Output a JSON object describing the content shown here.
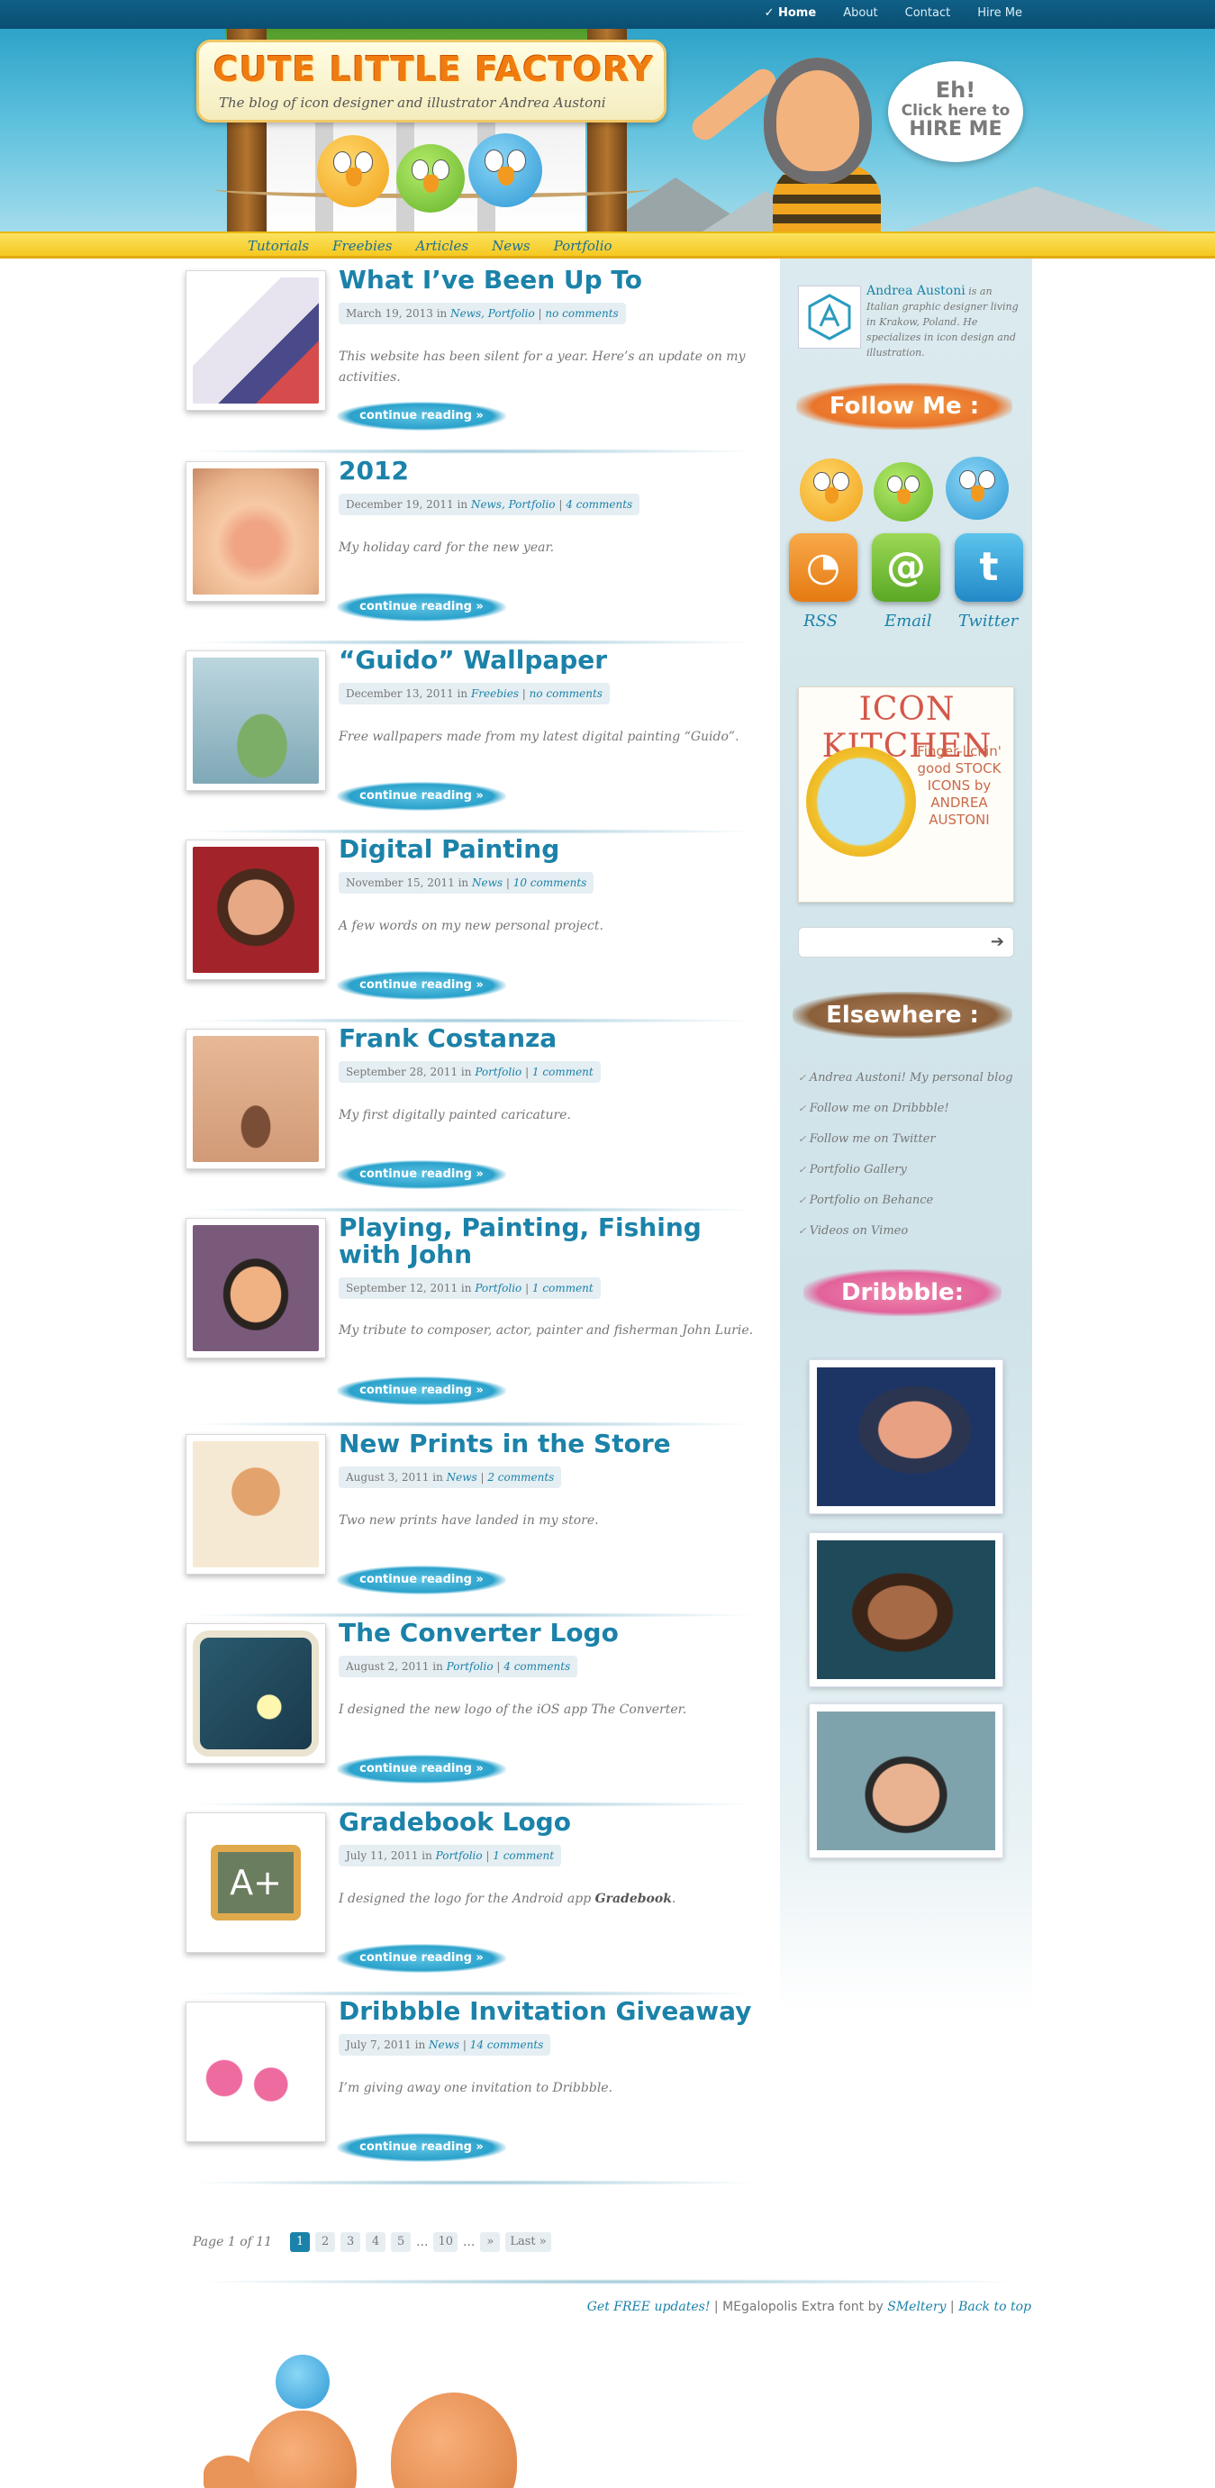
{
  "top_nav": [
    {
      "label": "Home",
      "active": true,
      "check": "✓"
    },
    {
      "label": "About"
    },
    {
      "label": "Contact"
    },
    {
      "label": "Hire Me"
    }
  ],
  "header": {
    "logo_title": "CUTE LITTLE FACTORY",
    "tagline": "The blog of icon designer and illustrator Andrea Austoni",
    "speech_l1": "Eh!",
    "speech_l2": "Click here to",
    "speech_l3": "HIRE ME"
  },
  "categories": [
    "Tutorials",
    "Freebies",
    "Articles",
    "News",
    "Portfolio"
  ],
  "posts": [
    {
      "title": "What I’ve Been Up To",
      "date": "March 19, 2013",
      "in": "in",
      "cats": "News, Portfolio",
      "comments": "no comments",
      "excerpt": "This website has been silent for a year. Here’s an update on my activities.",
      "cta": "continue reading »",
      "thumb_icon": "card-king-caricature-icon"
    },
    {
      "title": "2012",
      "date": "December 19, 2011",
      "in": "in",
      "cats": "News, Portfolio",
      "comments": "4 comments",
      "excerpt": "My holiday card for the new year.",
      "cta": "continue reading »",
      "thumb_icon": "old-face-caricature-icon"
    },
    {
      "title": "“Guido” Wallpaper",
      "date": "December 13, 2011",
      "in": "in",
      "cats": "Freebies",
      "comments": "no comments",
      "excerpt": "Free wallpapers made from my latest digital painting “Guido”.",
      "cta": "continue reading »",
      "thumb_icon": "kiwi-bird-icon"
    },
    {
      "title": "Digital Painting",
      "date": "November 15, 2011",
      "in": "in",
      "cats": "News",
      "comments": "10 comments",
      "excerpt": "A few words on my new personal project.",
      "cta": "continue reading »",
      "thumb_icon": "boy-portrait-icon"
    },
    {
      "title": "Frank Costanza",
      "date": "September 28, 2011",
      "in": "in",
      "cats": "Portfolio",
      "comments": "1 comment",
      "excerpt": "My first digitally painted caricature.",
      "cta": "continue reading »",
      "thumb_icon": "mustache-face-icon"
    },
    {
      "title": "Playing, Painting, Fishing with John",
      "date": "September 12, 2011",
      "in": "in",
      "cats": "Portfolio",
      "comments": "1 comment",
      "excerpt": "My tribute to composer, actor, painter and fisherman John Lurie.",
      "cta": "continue reading »",
      "thumb_icon": "john-caricature-icon"
    },
    {
      "title": "New Prints in the Store",
      "date": "August 3, 2011",
      "in": "in",
      "cats": "News",
      "comments": "2 comments",
      "excerpt": "Two new prints have landed in my store.",
      "cta": "continue reading »",
      "thumb_icon": "print-character-icon"
    },
    {
      "title": "The Converter Logo",
      "date": "August 2, 2011",
      "in": "in",
      "cats": "Portfolio",
      "comments": "4 comments",
      "excerpt": "I designed the new logo of the iOS app The Converter.",
      "cta": "continue reading »",
      "thumb_icon": "converter-app-icon"
    },
    {
      "title": "Gradebook Logo",
      "date": "July 11, 2011",
      "in": "in",
      "cats": "Portfolio",
      "comments": "1 comment",
      "excerpt_pre": "I designed the logo for the Android app ",
      "excerpt_bold": "Gradebook",
      "excerpt_post": ".",
      "cta": "continue reading »",
      "thumb_icon": "gradebook-a-plus-icon"
    },
    {
      "title": "Dribbble Invitation Giveaway",
      "date": "July 7, 2011",
      "in": "in",
      "cats": "News",
      "comments": "14 comments",
      "excerpt": "I’m giving away one invitation to Dribbble.",
      "cta": "continue reading »",
      "thumb_icon": "dribbble-balls-icon"
    }
  ],
  "pagination": {
    "info": "Page 1 of 11",
    "pages": [
      "1",
      "2",
      "3",
      "4",
      "5"
    ],
    "dots": "...",
    "ten": "10",
    "next": "»",
    "last": "Last »"
  },
  "sidebar": {
    "author_name": "Andrea Austoni",
    "author_bio": " is an Italian graphic designer living in Krakow, Poland. He specializes in icon design and illustration.",
    "follow_heading": "Follow Me :",
    "social": [
      {
        "label": "RSS",
        "icon": "rss-icon",
        "color": "#ef8a22"
      },
      {
        "label": "Email",
        "icon": "at-icon",
        "color": "#7cc237"
      },
      {
        "label": "Twitter",
        "icon": "twitter-icon",
        "color": "#33a8de"
      }
    ],
    "icon_kitchen_title": "ICON KITCHEN",
    "icon_kitchen_sub": "Finger-lickin' good STOCK ICONS by ANDREA AUSTONI",
    "search_placeholder": "",
    "search_go": "➔",
    "elsewhere_heading": "Elsewhere :",
    "links": [
      "Andrea Austoni! My personal blog",
      "Follow me on Dribbble!",
      "Follow me on Twitter",
      "Portfolio Gallery",
      "Portfolio on Behance",
      "Videos on Vimeo"
    ],
    "dribbble_heading": "Dribbble:",
    "shots": [
      "politician-caricature-shot",
      "woman-caricature-shot",
      "glasses-man-caricature-shot"
    ]
  },
  "footer": {
    "updates": "Get FREE updates!",
    "sep": " | ",
    "font_credit": "MEgalopolis Extra font by ",
    "smeltery": "SMeltery",
    "back_top": "Back to top"
  },
  "colors": {
    "accent": "#1b82a9",
    "nav_bg": "#0f5f86",
    "category_bar": "#f5c920"
  }
}
